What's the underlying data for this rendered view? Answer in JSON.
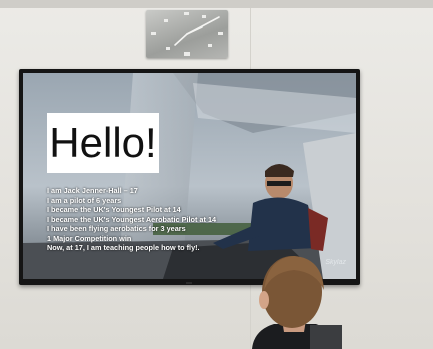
{
  "slide": {
    "heading": "Hello!",
    "bullets": [
      "I am Jack Jenner-Hall – 17",
      "I am a pilot of 6 years",
      "I became the UK's Youngest Pilot at 14",
      "I became the UK's Youngest Aerobatic Pilot at 14",
      "I have been flying aerobatics for 3 years",
      "1 Major Competition win",
      "Now, at 17, I am teaching people how to fly!."
    ],
    "glider_mark": "Skylaz"
  },
  "colors": {
    "wall": "#e3e1dc",
    "tv_bezel": "#151515",
    "slide_text": "#ffffff",
    "hello_box": "#ffffff"
  },
  "icons": {
    "clock": "wall-clock-icon"
  }
}
